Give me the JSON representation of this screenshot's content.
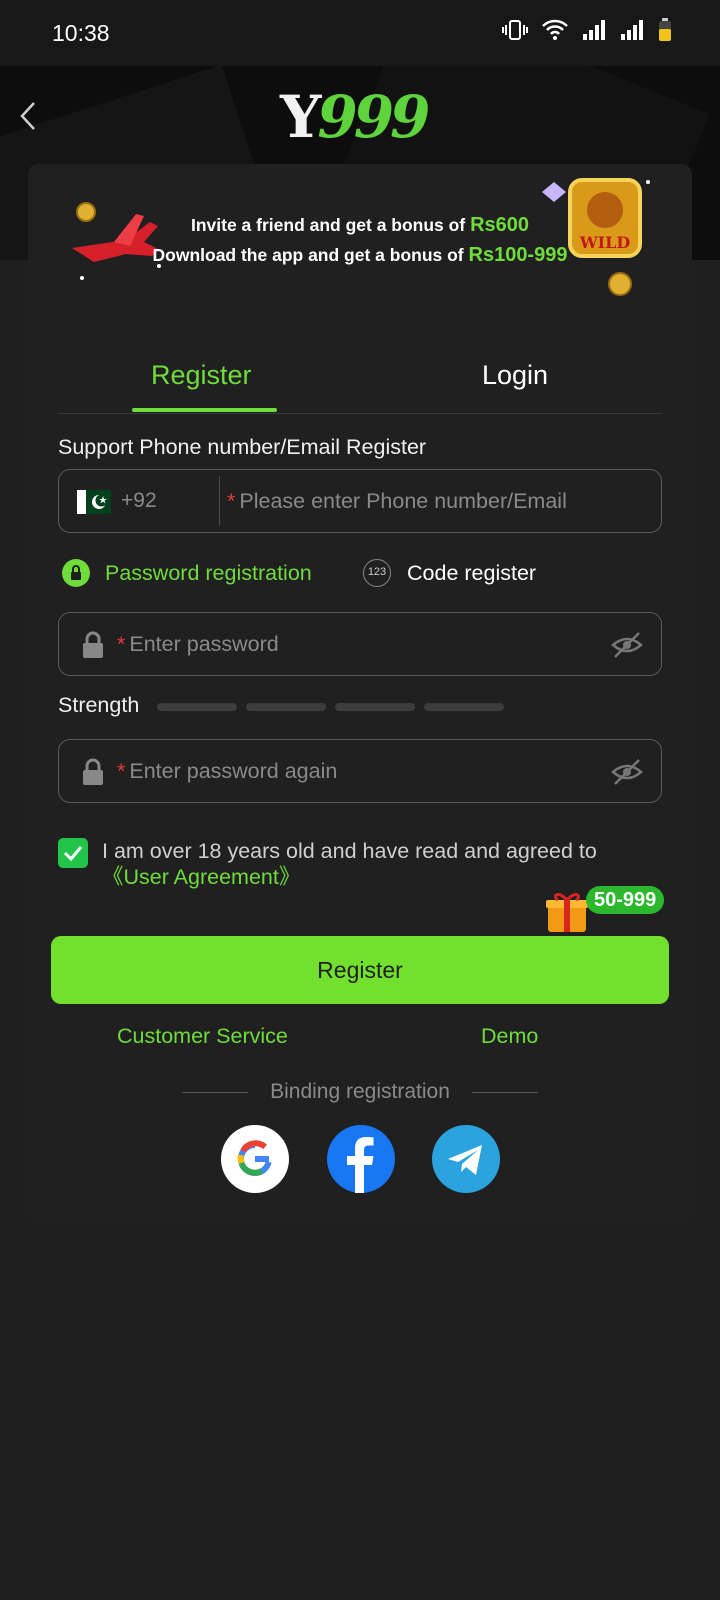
{
  "status_bar": {
    "time": "10:38"
  },
  "header": {
    "logo_y": "Y",
    "logo_n": "999"
  },
  "promo": {
    "line1_text": "Invite a friend and get a bonus of",
    "line1_amount": "Rs600",
    "line2_text": "Download the app and get a bonus of",
    "line2_amount": "Rs100-999",
    "wild_label": "WILD"
  },
  "tabs": {
    "register": "Register",
    "login": "Login",
    "active": "register"
  },
  "form": {
    "phone_label": "Support Phone number/Email Register",
    "country_code": "+92",
    "phone_placeholder": "Please enter Phone number/Email",
    "mode_password": "Password registration",
    "mode_code": "Code register",
    "code_icon_text": "123",
    "password_placeholder": "Enter password",
    "strength_label": "Strength",
    "strength_level": 0,
    "password_again_placeholder": "Enter password again",
    "agree_text": "I am over 18 years old and have read and agreed to",
    "agree_link": "《User Agreement》",
    "agreed": true,
    "gift_badge": "50-999",
    "register_button": "Register"
  },
  "links": {
    "customer_service": "Customer Service",
    "demo": "Demo"
  },
  "binding": {
    "label": "Binding registration",
    "providers": [
      "google",
      "facebook",
      "telegram"
    ]
  },
  "colors": {
    "accent": "#73e02e",
    "text_green": "#6fdc3c",
    "background": "#1f1f1f",
    "card": "#202020"
  }
}
